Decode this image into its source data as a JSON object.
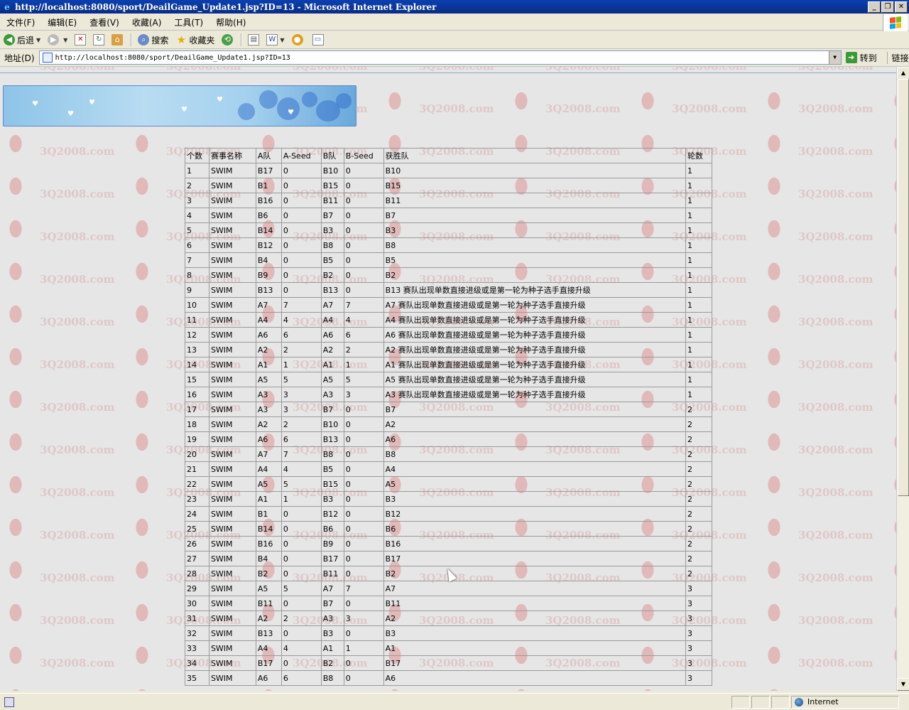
{
  "window": {
    "title": "http://localhost:8080/sport/DeailGame_Update1.jsp?ID=13 - Microsoft Internet Explorer",
    "minimize": "_",
    "restore": "❐",
    "close": "✕"
  },
  "menu": [
    "文件(F)",
    "编辑(E)",
    "查看(V)",
    "收藏(A)",
    "工具(T)",
    "帮助(H)"
  ],
  "toolbar": {
    "back_label": "后退",
    "search_label": "搜索",
    "favorites_label": "收藏夹"
  },
  "address": {
    "label": "地址(D)",
    "url": "http://localhost:8080/sport/DeailGame_Update1.jsp?ID=13",
    "go_label": "转到",
    "links_label": "链接"
  },
  "watermark_text": "3Q2008.com",
  "table": {
    "headers": [
      "个数",
      "赛事名称",
      "A队",
      "A-Seed",
      "B队",
      "B-Seed",
      "获胜队",
      "轮数"
    ],
    "rows": [
      [
        "1",
        "SWIM",
        "B17",
        "0",
        "B10",
        "0",
        "B10",
        "1"
      ],
      [
        "2",
        "SWIM",
        "B1",
        "0",
        "B15",
        "0",
        "B15",
        "1"
      ],
      [
        "3",
        "SWIM",
        "B16",
        "0",
        "B11",
        "0",
        "B11",
        "1"
      ],
      [
        "4",
        "SWIM",
        "B6",
        "0",
        "B7",
        "0",
        "B7",
        "1"
      ],
      [
        "5",
        "SWIM",
        "B14",
        "0",
        "B3",
        "0",
        "B3",
        "1"
      ],
      [
        "6",
        "SWIM",
        "B12",
        "0",
        "B8",
        "0",
        "B8",
        "1"
      ],
      [
        "7",
        "SWIM",
        "B4",
        "0",
        "B5",
        "0",
        "B5",
        "1"
      ],
      [
        "8",
        "SWIM",
        "B9",
        "0",
        "B2",
        "0",
        "B2",
        "1"
      ],
      [
        "9",
        "SWIM",
        "B13",
        "0",
        "B13",
        "0",
        "B13 赛队出现单数直接进级或是第一轮为种子选手直接升级",
        "1"
      ],
      [
        "10",
        "SWIM",
        "A7",
        "7",
        "A7",
        "7",
        "A7 赛队出现单数直接进级或是第一轮为种子选手直接升级",
        "1"
      ],
      [
        "11",
        "SWIM",
        "A4",
        "4",
        "A4",
        "4",
        "A4 赛队出现单数直接进级或是第一轮为种子选手直接升级",
        "1"
      ],
      [
        "12",
        "SWIM",
        "A6",
        "6",
        "A6",
        "6",
        "A6 赛队出现单数直接进级或是第一轮为种子选手直接升级",
        "1"
      ],
      [
        "13",
        "SWIM",
        "A2",
        "2",
        "A2",
        "2",
        "A2 赛队出现单数直接进级或是第一轮为种子选手直接升级",
        "1"
      ],
      [
        "14",
        "SWIM",
        "A1",
        "1",
        "A1",
        "1",
        "A1 赛队出现单数直接进级或是第一轮为种子选手直接升级",
        "1"
      ],
      [
        "15",
        "SWIM",
        "A5",
        "5",
        "A5",
        "5",
        "A5 赛队出现单数直接进级或是第一轮为种子选手直接升级",
        "1"
      ],
      [
        "16",
        "SWIM",
        "A3",
        "3",
        "A3",
        "3",
        "A3 赛队出现单数直接进级或是第一轮为种子选手直接升级",
        "1"
      ],
      [
        "17",
        "SWIM",
        "A3",
        "3",
        "B7",
        "0",
        "B7",
        "2"
      ],
      [
        "18",
        "SWIM",
        "A2",
        "2",
        "B10",
        "0",
        "A2",
        "2"
      ],
      [
        "19",
        "SWIM",
        "A6",
        "6",
        "B13",
        "0",
        "A6",
        "2"
      ],
      [
        "20",
        "SWIM",
        "A7",
        "7",
        "B8",
        "0",
        "B8",
        "2"
      ],
      [
        "21",
        "SWIM",
        "A4",
        "4",
        "B5",
        "0",
        "A4",
        "2"
      ],
      [
        "22",
        "SWIM",
        "A5",
        "5",
        "B15",
        "0",
        "A5",
        "2"
      ],
      [
        "23",
        "SWIM",
        "A1",
        "1",
        "B3",
        "0",
        "B3",
        "2"
      ],
      [
        "24",
        "SWIM",
        "B1",
        "0",
        "B12",
        "0",
        "B12",
        "2"
      ],
      [
        "25",
        "SWIM",
        "B14",
        "0",
        "B6",
        "0",
        "B6",
        "2"
      ],
      [
        "26",
        "SWIM",
        "B16",
        "0",
        "B9",
        "0",
        "B16",
        "2"
      ],
      [
        "27",
        "SWIM",
        "B4",
        "0",
        "B17",
        "0",
        "B17",
        "2"
      ],
      [
        "28",
        "SWIM",
        "B2",
        "0",
        "B11",
        "0",
        "B2",
        "2"
      ],
      [
        "29",
        "SWIM",
        "A5",
        "5",
        "A7",
        "7",
        "A7",
        "3"
      ],
      [
        "30",
        "SWIM",
        "B11",
        "0",
        "B7",
        "0",
        "B11",
        "3"
      ],
      [
        "31",
        "SWIM",
        "A2",
        "2",
        "A3",
        "3",
        "A2",
        "3"
      ],
      [
        "32",
        "SWIM",
        "B13",
        "0",
        "B3",
        "0",
        "B3",
        "3"
      ],
      [
        "33",
        "SWIM",
        "A4",
        "4",
        "A1",
        "1",
        "A1",
        "3"
      ],
      [
        "34",
        "SWIM",
        "B17",
        "0",
        "B2",
        "0",
        "B17",
        "3"
      ],
      [
        "35",
        "SWIM",
        "A6",
        "6",
        "B8",
        "0",
        "A6",
        "3"
      ]
    ]
  },
  "status": {
    "zone": "Internet"
  }
}
